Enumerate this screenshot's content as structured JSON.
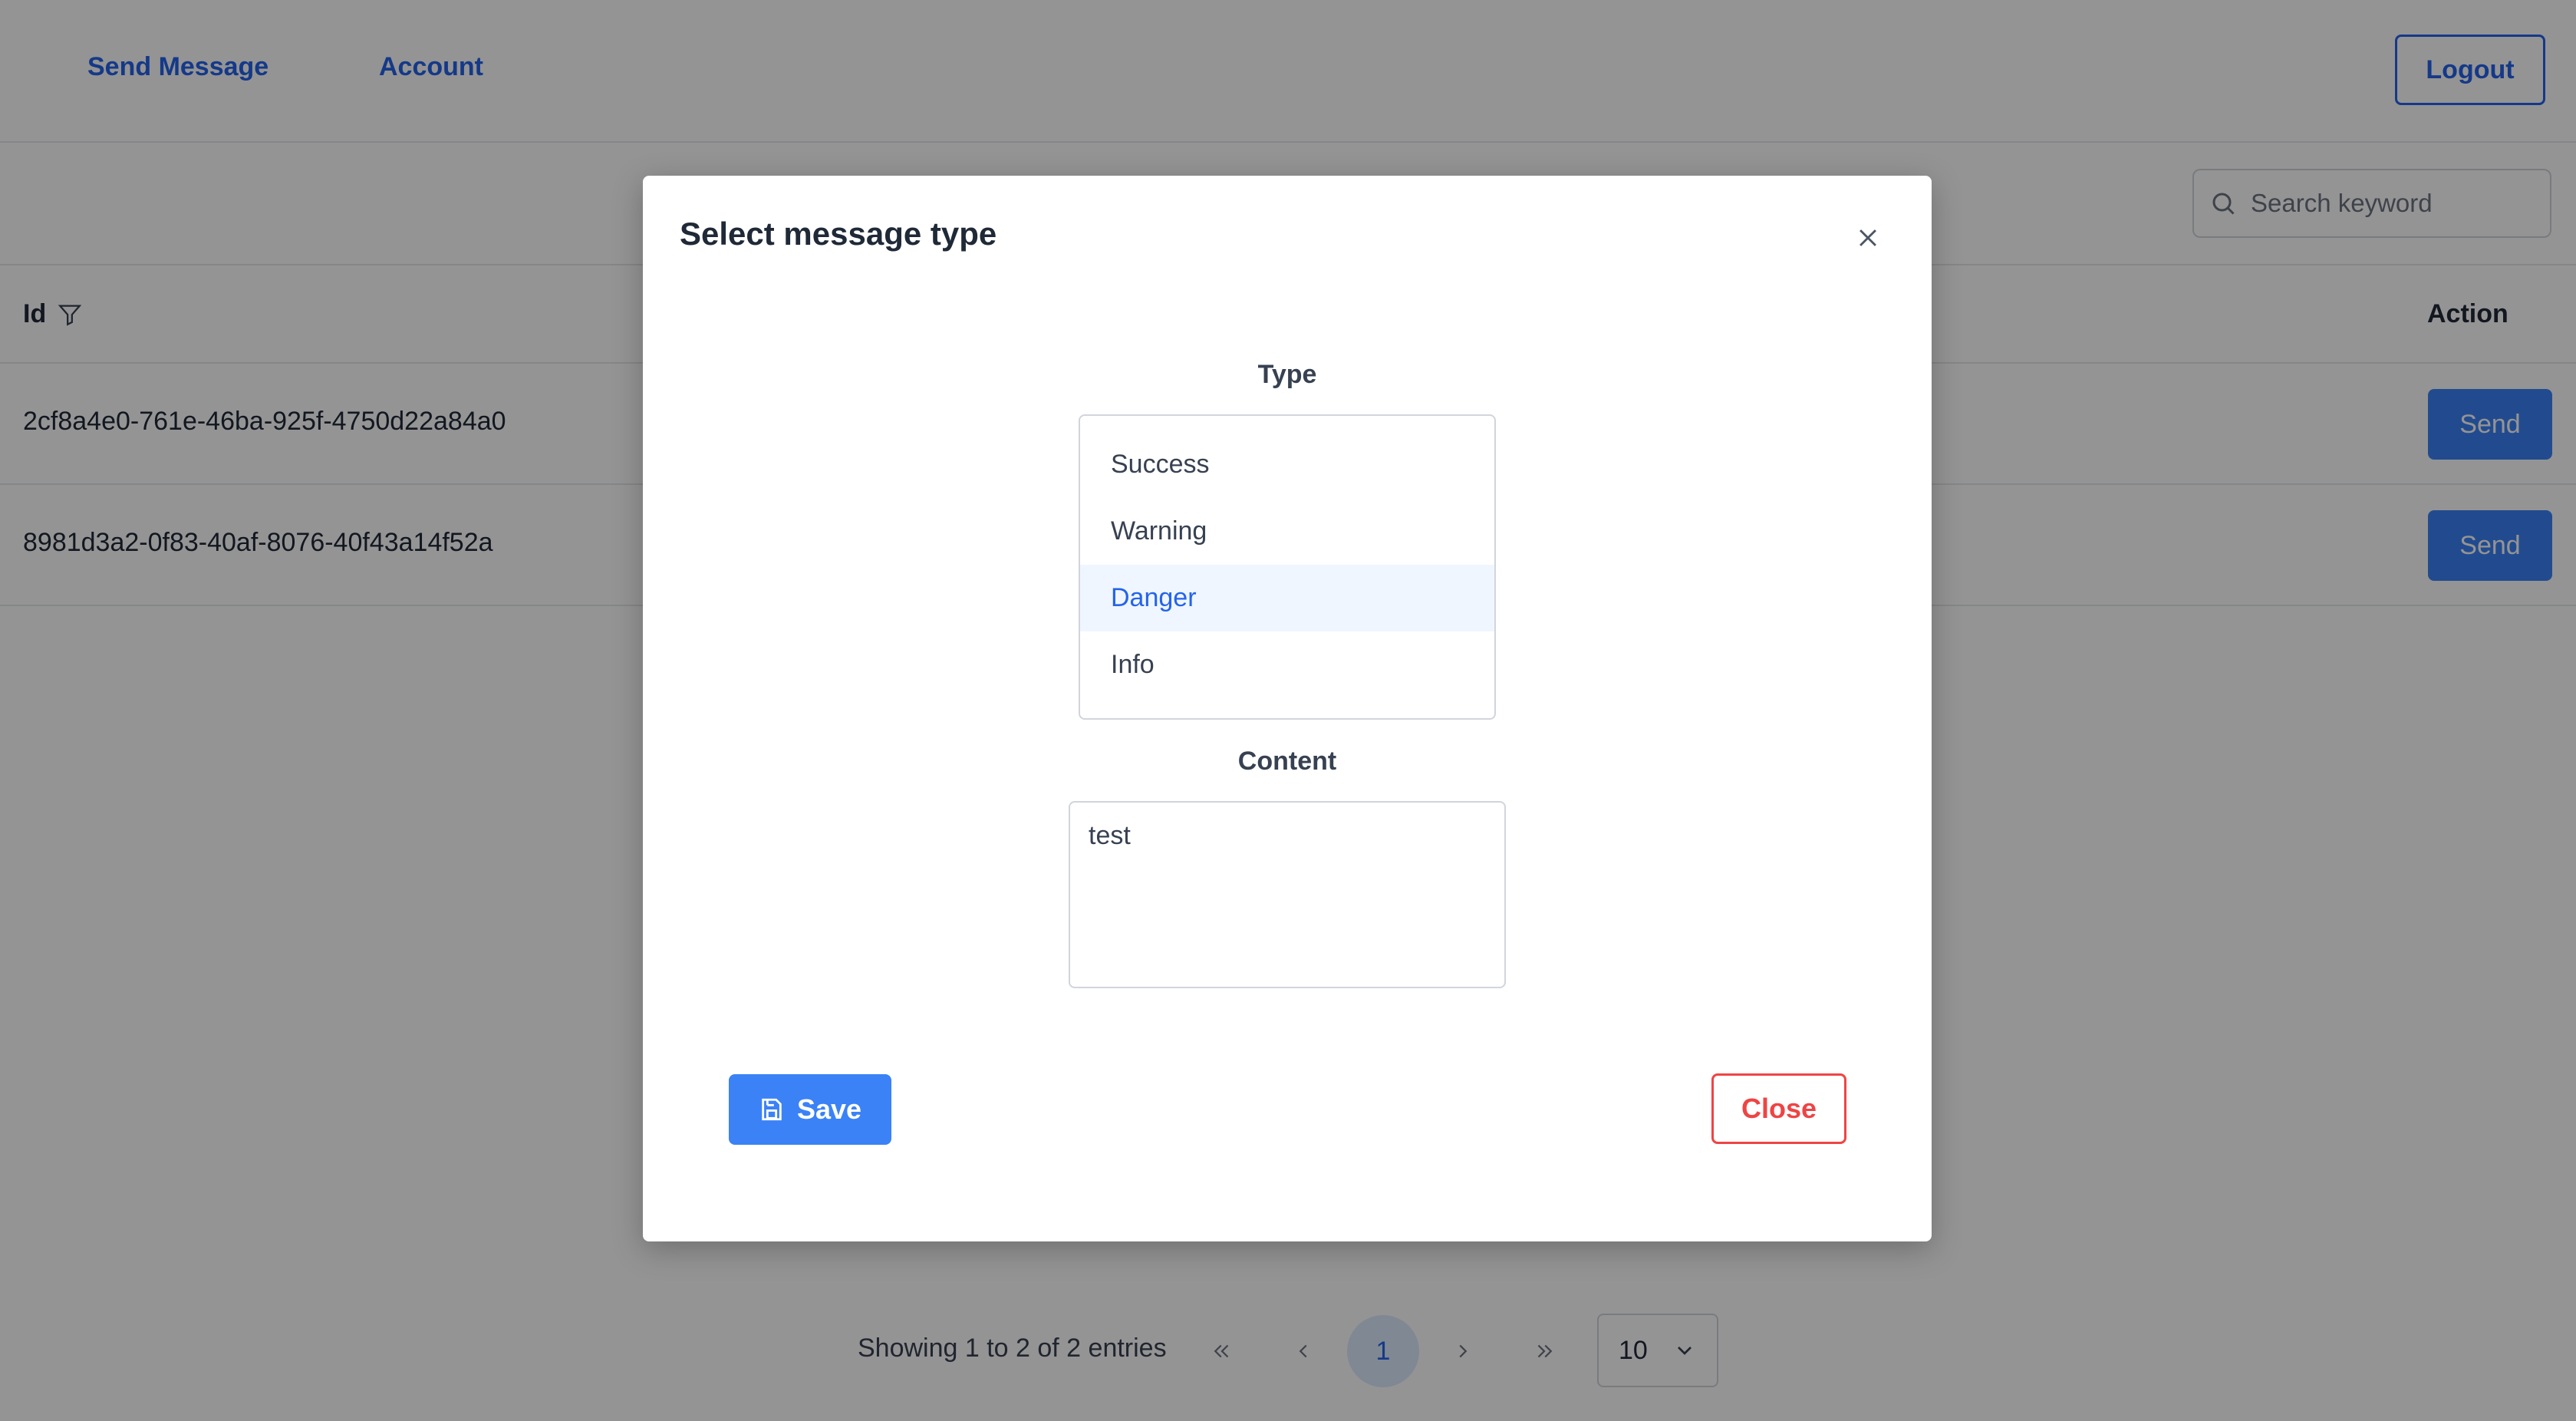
{
  "nav": {
    "send_message": "Send Message",
    "account": "Account",
    "logout": "Logout"
  },
  "search": {
    "placeholder": "Search keyword",
    "icon": "search-icon"
  },
  "table": {
    "columns": {
      "id": "Id",
      "action": "Action"
    },
    "rows": [
      {
        "id": "2cf8a4e0-761e-46ba-925f-4750d22a84a0",
        "action": "Send"
      },
      {
        "id": "8981d3a2-0f83-40af-8076-40f43a14f52a",
        "action": "Send"
      }
    ]
  },
  "pagination": {
    "info": "Showing 1 to 2 of 2 entries",
    "current_page": "1",
    "page_size": "10"
  },
  "modal": {
    "title": "Select message type",
    "type_label": "Type",
    "options": [
      "Success",
      "Warning",
      "Danger",
      "Info"
    ],
    "selected_option": "Danger",
    "content_label": "Content",
    "content_value": "test",
    "save_label": "Save",
    "close_label": "Close"
  },
  "colors": {
    "primary": "#3b82f6",
    "link": "#2563eb",
    "danger": "#ef4444",
    "selected_bg": "#eff6ff"
  }
}
